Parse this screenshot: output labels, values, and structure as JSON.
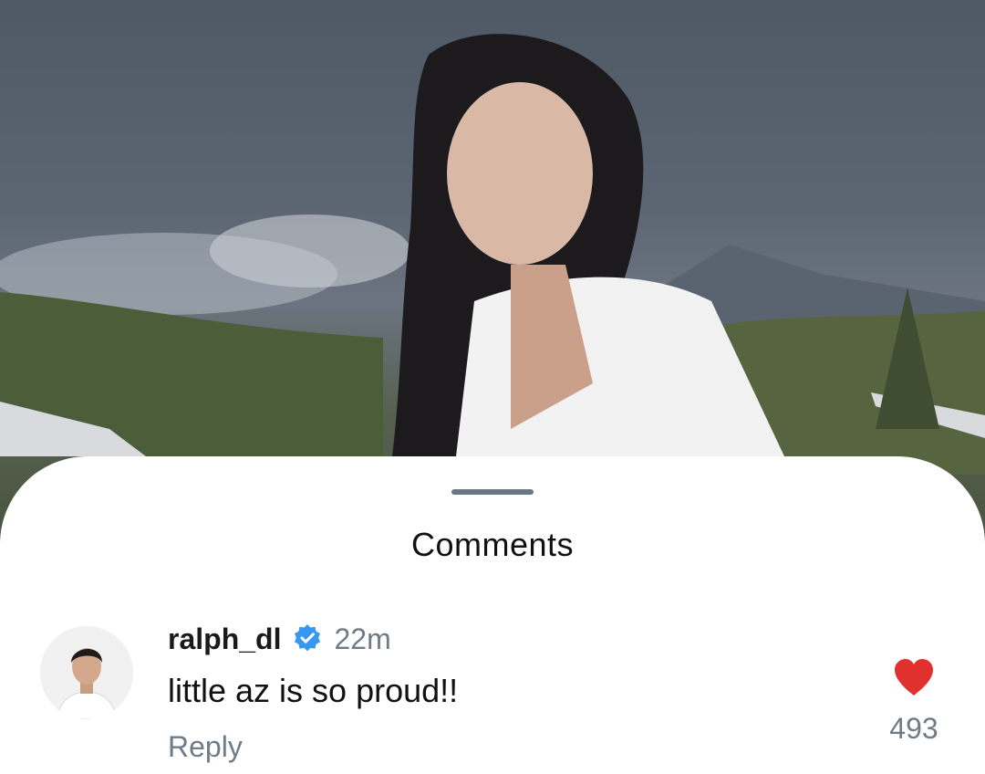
{
  "sheet": {
    "title": "Comments"
  },
  "comment": {
    "username": "ralph_dl",
    "verified": true,
    "timestamp": "22m",
    "text": "little az is so proud!!",
    "reply_label": "Reply",
    "likes": "493",
    "liked": true
  },
  "icons": {
    "verified": "verified-badge-icon",
    "like": "heart-icon"
  },
  "colors": {
    "verified_badge": "#3897f0",
    "heart": "#e0312f",
    "muted_text": "#6f7b86"
  }
}
